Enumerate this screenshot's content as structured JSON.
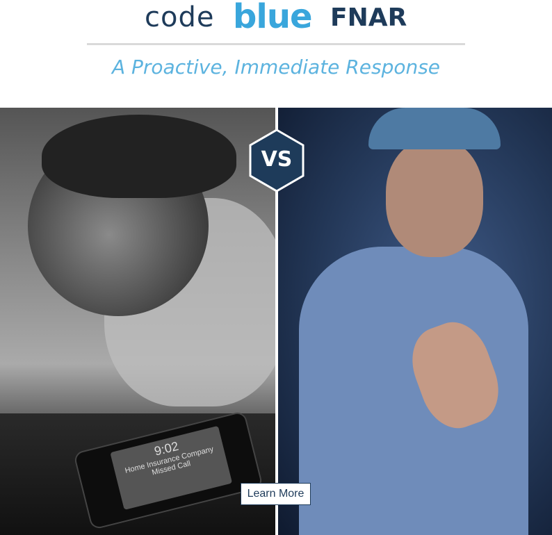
{
  "logo": {
    "part1": "code",
    "part2": "blue",
    "part3": "FNAR"
  },
  "tagline": "A Proactive, Immediate Response",
  "badge": {
    "text": "VS"
  },
  "phone": {
    "time": "9:02",
    "caller": "Home Insurance Company",
    "status": "Missed Call"
  },
  "cta": {
    "label": "Learn More"
  },
  "colors": {
    "navy": "#1e3b5a",
    "blue": "#39a6dc",
    "light_blue": "#5cb3df"
  }
}
